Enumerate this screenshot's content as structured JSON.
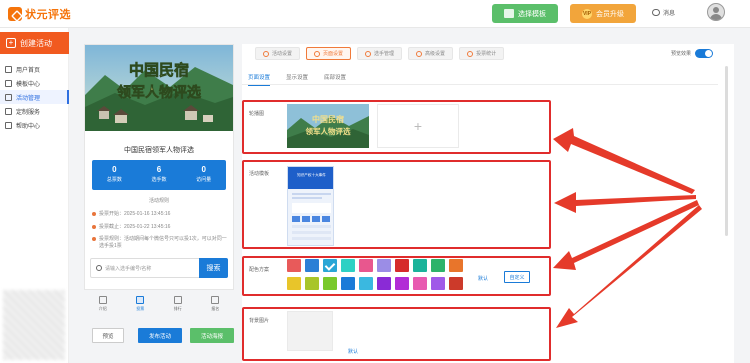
{
  "header": {
    "logo_text": "状元评选",
    "template_center_button": "选择模板",
    "vip_button": "会员升级",
    "vip_badge": "VIP",
    "messages_label": "消息"
  },
  "sidebar": {
    "create_button": "创建活动",
    "items": [
      {
        "label": "用户首页"
      },
      {
        "label": "模板中心"
      },
      {
        "label": "活动管理"
      },
      {
        "label": "定制服务"
      },
      {
        "label": "帮助中心"
      }
    ]
  },
  "preview": {
    "hero_title_line1": "中国民宿",
    "hero_title_line2": "领军人物评选",
    "card_title": "中国民宿领军人物评选",
    "stats": [
      {
        "num": "0",
        "label": "总票数"
      },
      {
        "num": "6",
        "label": "选手数"
      },
      {
        "num": "0",
        "label": "访问量"
      }
    ],
    "rules_head": "活动规则",
    "rules": [
      "投票开始：2025-01-16 13:45:16",
      "投票截止：2025-01-22 13:45:16",
      "投票规则：活动期间每个微信号只可以投1次，可以对同一选手投1票"
    ],
    "search_placeholder": "请输入选手编号/名称",
    "search_button": "搜索",
    "tabbar": [
      {
        "label": "介绍"
      },
      {
        "label": "投票"
      },
      {
        "label": "排行"
      },
      {
        "label": "报名"
      }
    ],
    "buttons": {
      "prev": "预览",
      "publish": "发布活动",
      "draft": "活动海报"
    }
  },
  "panel": {
    "steps": [
      {
        "label": "活动设置"
      },
      {
        "label": "页面设置"
      },
      {
        "label": "选手管理"
      },
      {
        "label": "高级设置"
      },
      {
        "label": "投票统计"
      }
    ],
    "preview_toggle_label": "预览效果",
    "subtabs": [
      "页面设置",
      "显示设置",
      "底部设置"
    ],
    "sections": {
      "banner_label": "轮播图",
      "template_label": "活动模板",
      "color_label": "配色方案",
      "background_label": "背景图片"
    },
    "template_thumb_title": "知识产权十大事件",
    "default_link": "默认",
    "custom_button": "自定义",
    "bg_default_link": "默认"
  },
  "colors": {
    "brand_orange": "#f15a1f",
    "primary_blue": "#1a7bd8",
    "highlight_red": "#e02c2c",
    "swatch_row1": [
      "#e85a5a",
      "#2b7fd6",
      "#2aa6d6",
      "#2ed1c4",
      "#e8578e",
      "#9b8de6",
      "#d62b2b",
      "#1bb39a",
      "#2db36a",
      "#e8752b"
    ],
    "swatch_row2": [
      "#e8c52a",
      "#a8c52a",
      "#7ac92a",
      "#1a7bd8",
      "#3ab8e0",
      "#8a2bd6",
      "#b22bd6",
      "#e85ab0",
      "#a05ae8",
      "#cc3a2a"
    ]
  }
}
